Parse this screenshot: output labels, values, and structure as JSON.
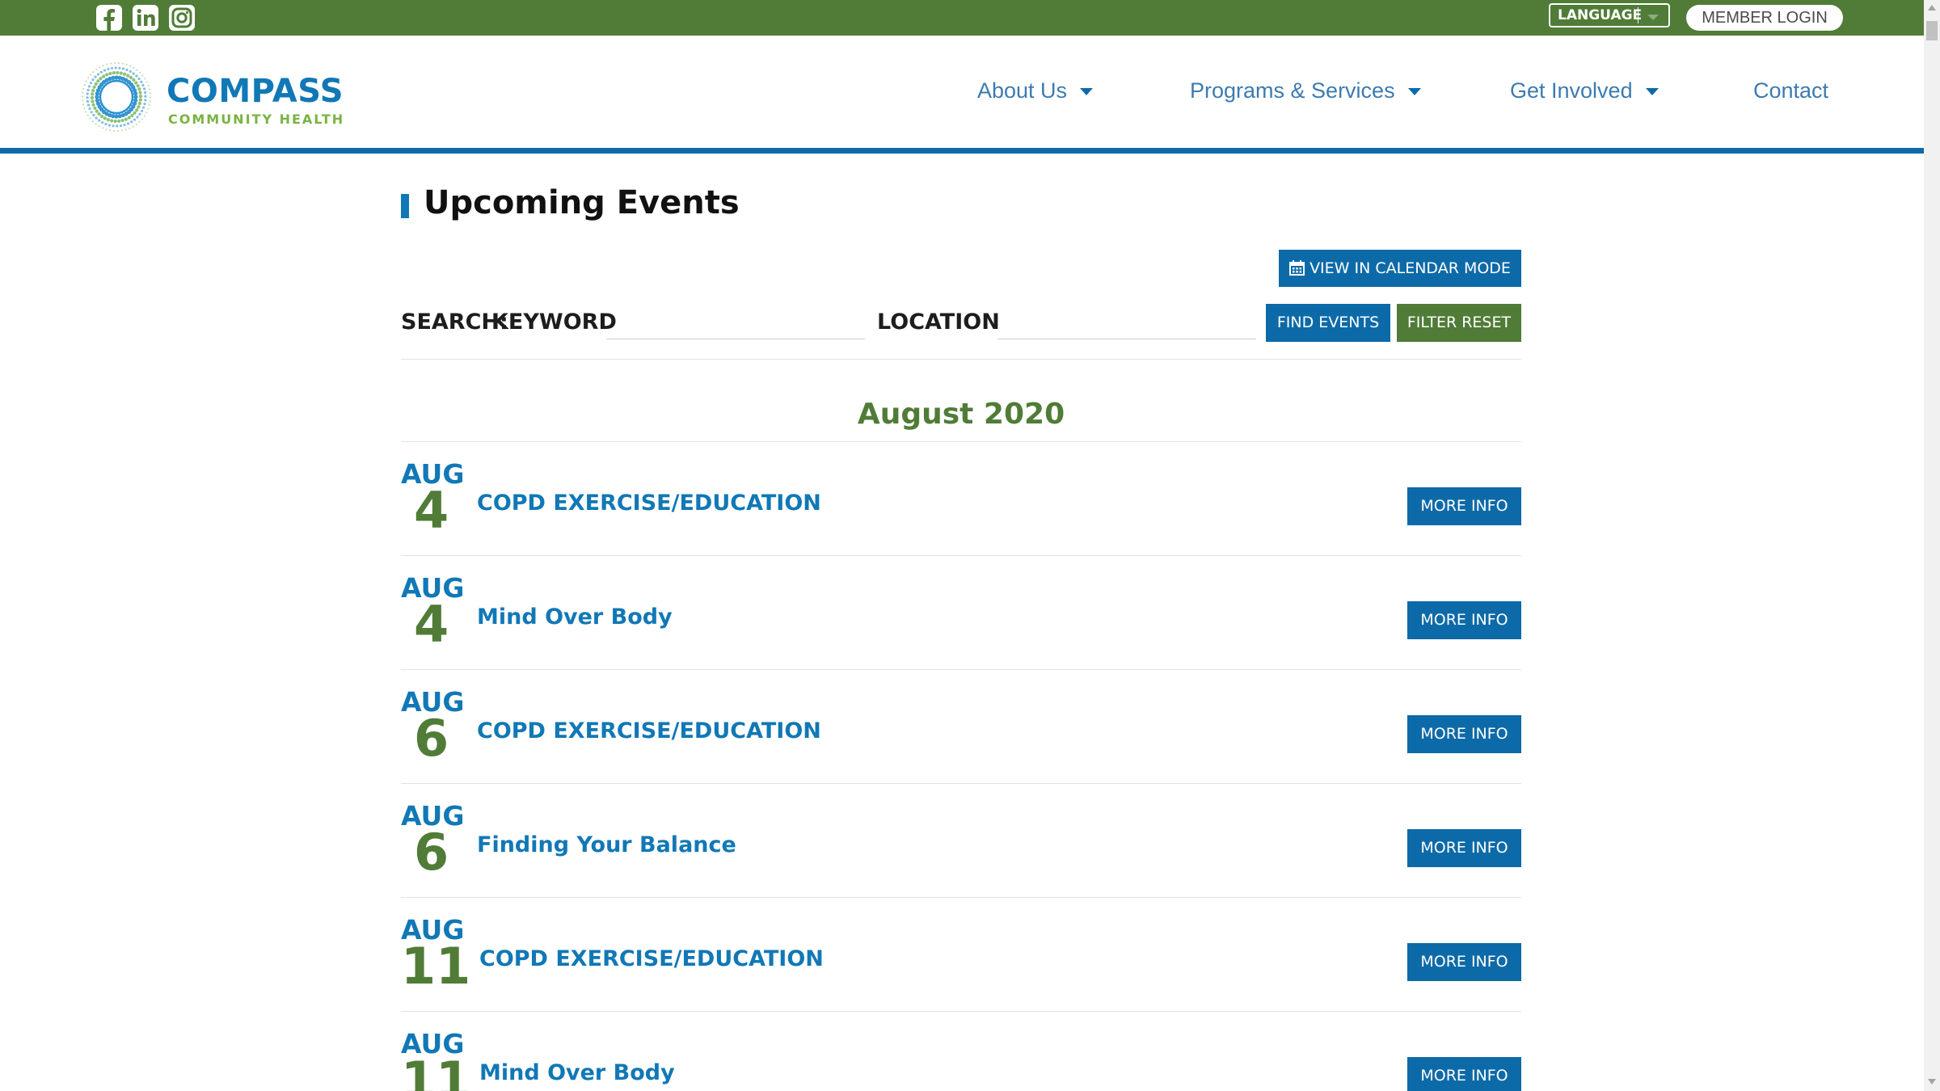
{
  "topbar": {
    "social": [
      {
        "icon": "facebook-icon"
      },
      {
        "icon": "linkedin-icon"
      },
      {
        "icon": "instagram-icon"
      }
    ],
    "language_label": "LANGUAGE",
    "member_login_label": "MEMBER LOGIN"
  },
  "header": {
    "logo_name": "COMPASS",
    "logo_subtitle": "COMMUNITY HEALTH",
    "nav": [
      {
        "label": "About Us",
        "has_dropdown": true
      },
      {
        "label": "Programs & Services",
        "has_dropdown": true
      },
      {
        "label": "Get Involved",
        "has_dropdown": true
      },
      {
        "label": "Contact",
        "has_dropdown": false
      }
    ]
  },
  "main": {
    "title": "Upcoming Events",
    "calendar_button_label": "VIEW IN CALENDAR MODE",
    "search_label": "SEARCH:",
    "keyword_label": "KEYWORD",
    "keyword_value": "",
    "location_label": "LOCATION",
    "location_value": "",
    "find_button_label": "FIND EVENTS",
    "reset_button_label": "FILTER RESET",
    "month_heading": "August 2020",
    "more_info_label": "MORE INFO",
    "events": [
      {
        "month": "AUG",
        "day": "4",
        "name": "COPD EXERCISE/EDUCATION"
      },
      {
        "month": "AUG",
        "day": "4",
        "name": "Mind Over Body"
      },
      {
        "month": "AUG",
        "day": "6",
        "name": "COPD EXERCISE/EDUCATION"
      },
      {
        "month": "AUG",
        "day": "6",
        "name": "Finding Your Balance"
      },
      {
        "month": "AUG",
        "day": "11",
        "name": "COPD EXERCISE/EDUCATION"
      },
      {
        "month": "AUG",
        "day": "11",
        "name": "Mind Over Body"
      }
    ]
  },
  "colors": {
    "brand_green": "#507c37",
    "brand_blue": "#0d6aa8",
    "link_blue": "#1178b6"
  }
}
